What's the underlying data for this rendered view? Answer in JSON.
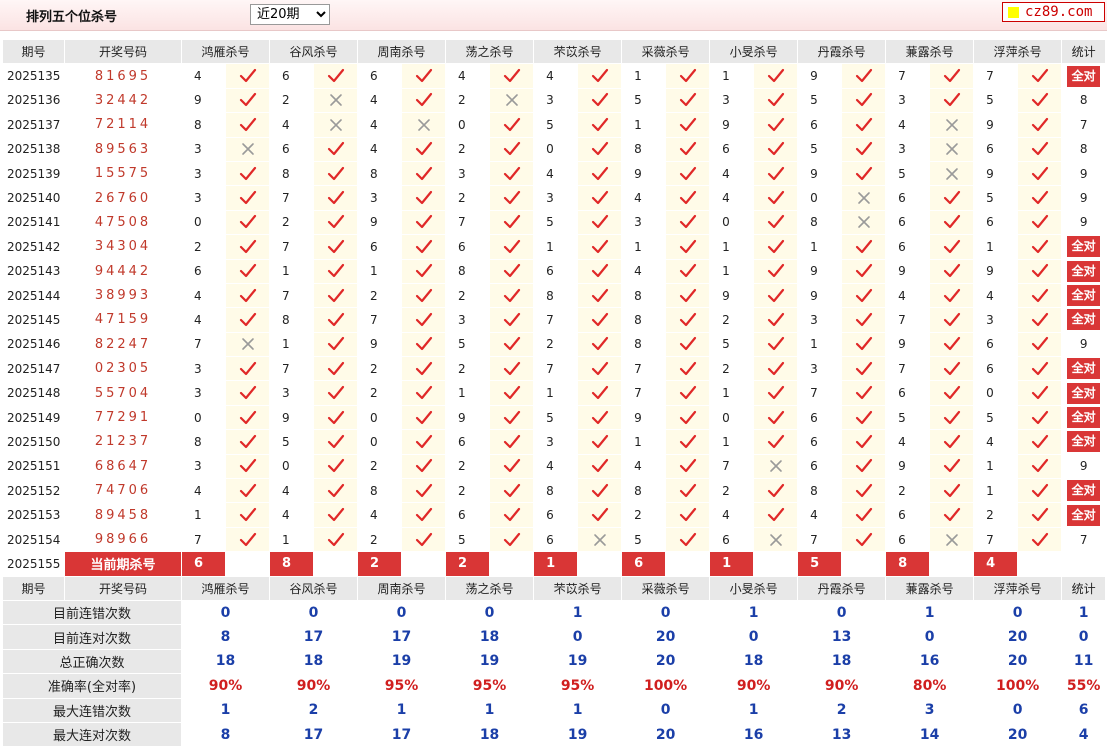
{
  "header": {
    "title": "排列五个位杀号",
    "range_selected": "近20期",
    "logo": "cz89.com"
  },
  "columns": {
    "period": "期号",
    "draw": "开奖号码",
    "experts": [
      "鸿雁杀号",
      "谷风杀号",
      "周南杀号",
      "荡之杀号",
      "芣苡杀号",
      "采薇杀号",
      "小旻杀号",
      "丹霞杀号",
      "蒹露杀号",
      "浮萍杀号"
    ],
    "stat": "统计"
  },
  "all_ok_label": "全对",
  "rows": [
    {
      "period": "2025135",
      "draw": "81695",
      "kills": [
        [
          4,
          1
        ],
        [
          6,
          1
        ],
        [
          6,
          1
        ],
        [
          4,
          1
        ],
        [
          4,
          1
        ],
        [
          1,
          1
        ],
        [
          1,
          1
        ],
        [
          9,
          1
        ],
        [
          7,
          1
        ],
        [
          7,
          1
        ]
      ],
      "stat": "全对"
    },
    {
      "period": "2025136",
      "draw": "32442",
      "kills": [
        [
          9,
          1
        ],
        [
          2,
          0
        ],
        [
          4,
          1
        ],
        [
          2,
          0
        ],
        [
          3,
          1
        ],
        [
          5,
          1
        ],
        [
          3,
          1
        ],
        [
          5,
          1
        ],
        [
          3,
          1
        ],
        [
          5,
          1
        ]
      ],
      "stat": "8"
    },
    {
      "period": "2025137",
      "draw": "72114",
      "kills": [
        [
          8,
          1
        ],
        [
          4,
          0
        ],
        [
          4,
          0
        ],
        [
          0,
          1
        ],
        [
          5,
          1
        ],
        [
          1,
          1
        ],
        [
          9,
          1
        ],
        [
          6,
          1
        ],
        [
          4,
          0
        ],
        [
          9,
          1
        ]
      ],
      "stat": "7"
    },
    {
      "period": "2025138",
      "draw": "89563",
      "kills": [
        [
          3,
          0
        ],
        [
          6,
          1
        ],
        [
          4,
          1
        ],
        [
          2,
          1
        ],
        [
          0,
          1
        ],
        [
          8,
          1
        ],
        [
          6,
          1
        ],
        [
          5,
          1
        ],
        [
          3,
          0
        ],
        [
          6,
          1
        ]
      ],
      "stat": "8"
    },
    {
      "period": "2025139",
      "draw": "15575",
      "kills": [
        [
          3,
          1
        ],
        [
          8,
          1
        ],
        [
          8,
          1
        ],
        [
          3,
          1
        ],
        [
          4,
          1
        ],
        [
          9,
          1
        ],
        [
          4,
          1
        ],
        [
          9,
          1
        ],
        [
          5,
          0
        ],
        [
          9,
          1
        ]
      ],
      "stat": "9"
    },
    {
      "period": "2025140",
      "draw": "26760",
      "kills": [
        [
          3,
          1
        ],
        [
          7,
          1
        ],
        [
          3,
          1
        ],
        [
          2,
          1
        ],
        [
          3,
          1
        ],
        [
          4,
          1
        ],
        [
          4,
          1
        ],
        [
          0,
          0
        ],
        [
          6,
          1
        ],
        [
          5,
          1
        ]
      ],
      "stat": "9"
    },
    {
      "period": "2025141",
      "draw": "47508",
      "kills": [
        [
          0,
          1
        ],
        [
          2,
          1
        ],
        [
          9,
          1
        ],
        [
          7,
          1
        ],
        [
          5,
          1
        ],
        [
          3,
          1
        ],
        [
          0,
          1
        ],
        [
          8,
          0
        ],
        [
          6,
          1
        ],
        [
          6,
          1
        ]
      ],
      "stat": "9"
    },
    {
      "period": "2025142",
      "draw": "34304",
      "kills": [
        [
          2,
          1
        ],
        [
          7,
          1
        ],
        [
          6,
          1
        ],
        [
          6,
          1
        ],
        [
          1,
          1
        ],
        [
          1,
          1
        ],
        [
          1,
          1
        ],
        [
          1,
          1
        ],
        [
          6,
          1
        ],
        [
          1,
          1
        ]
      ],
      "stat": "全对"
    },
    {
      "period": "2025143",
      "draw": "94442",
      "kills": [
        [
          6,
          1
        ],
        [
          1,
          1
        ],
        [
          1,
          1
        ],
        [
          8,
          1
        ],
        [
          6,
          1
        ],
        [
          4,
          1
        ],
        [
          1,
          1
        ],
        [
          9,
          1
        ],
        [
          9,
          1
        ],
        [
          9,
          1
        ]
      ],
      "stat": "全对"
    },
    {
      "period": "2025144",
      "draw": "38993",
      "kills": [
        [
          4,
          1
        ],
        [
          7,
          1
        ],
        [
          2,
          1
        ],
        [
          2,
          1
        ],
        [
          8,
          1
        ],
        [
          8,
          1
        ],
        [
          9,
          1
        ],
        [
          9,
          1
        ],
        [
          4,
          1
        ],
        [
          4,
          1
        ]
      ],
      "stat": "全对"
    },
    {
      "period": "2025145",
      "draw": "47159",
      "kills": [
        [
          4,
          1
        ],
        [
          8,
          1
        ],
        [
          7,
          1
        ],
        [
          3,
          1
        ],
        [
          7,
          1
        ],
        [
          8,
          1
        ],
        [
          2,
          1
        ],
        [
          3,
          1
        ],
        [
          7,
          1
        ],
        [
          3,
          1
        ]
      ],
      "stat": "全对"
    },
    {
      "period": "2025146",
      "draw": "82247",
      "kills": [
        [
          7,
          0
        ],
        [
          1,
          1
        ],
        [
          9,
          1
        ],
        [
          5,
          1
        ],
        [
          2,
          1
        ],
        [
          8,
          1
        ],
        [
          5,
          1
        ],
        [
          1,
          1
        ],
        [
          9,
          1
        ],
        [
          6,
          1
        ]
      ],
      "stat": "9"
    },
    {
      "period": "2025147",
      "draw": "02305",
      "kills": [
        [
          3,
          1
        ],
        [
          7,
          1
        ],
        [
          2,
          1
        ],
        [
          2,
          1
        ],
        [
          7,
          1
        ],
        [
          7,
          1
        ],
        [
          2,
          1
        ],
        [
          3,
          1
        ],
        [
          7,
          1
        ],
        [
          6,
          1
        ]
      ],
      "stat": "全对"
    },
    {
      "period": "2025148",
      "draw": "55704",
      "kills": [
        [
          3,
          1
        ],
        [
          3,
          1
        ],
        [
          2,
          1
        ],
        [
          1,
          1
        ],
        [
          1,
          1
        ],
        [
          7,
          1
        ],
        [
          1,
          1
        ],
        [
          7,
          1
        ],
        [
          6,
          1
        ],
        [
          0,
          1
        ]
      ],
      "stat": "全对"
    },
    {
      "period": "2025149",
      "draw": "77291",
      "kills": [
        [
          0,
          1
        ],
        [
          9,
          1
        ],
        [
          0,
          1
        ],
        [
          9,
          1
        ],
        [
          5,
          1
        ],
        [
          9,
          1
        ],
        [
          0,
          1
        ],
        [
          6,
          1
        ],
        [
          5,
          1
        ],
        [
          5,
          1
        ]
      ],
      "stat": "全对"
    },
    {
      "period": "2025150",
      "draw": "21237",
      "kills": [
        [
          8,
          1
        ],
        [
          5,
          1
        ],
        [
          0,
          1
        ],
        [
          6,
          1
        ],
        [
          3,
          1
        ],
        [
          1,
          1
        ],
        [
          1,
          1
        ],
        [
          6,
          1
        ],
        [
          4,
          1
        ],
        [
          4,
          1
        ]
      ],
      "stat": "全对"
    },
    {
      "period": "2025151",
      "draw": "68647",
      "kills": [
        [
          3,
          1
        ],
        [
          0,
          1
        ],
        [
          2,
          1
        ],
        [
          2,
          1
        ],
        [
          4,
          1
        ],
        [
          4,
          1
        ],
        [
          7,
          0
        ],
        [
          6,
          1
        ],
        [
          9,
          1
        ],
        [
          1,
          1
        ]
      ],
      "stat": "9"
    },
    {
      "period": "2025152",
      "draw": "74706",
      "kills": [
        [
          4,
          1
        ],
        [
          4,
          1
        ],
        [
          8,
          1
        ],
        [
          2,
          1
        ],
        [
          8,
          1
        ],
        [
          8,
          1
        ],
        [
          2,
          1
        ],
        [
          8,
          1
        ],
        [
          2,
          1
        ],
        [
          1,
          1
        ]
      ],
      "stat": "全对"
    },
    {
      "period": "2025153",
      "draw": "89458",
      "kills": [
        [
          1,
          1
        ],
        [
          4,
          1
        ],
        [
          4,
          1
        ],
        [
          6,
          1
        ],
        [
          6,
          1
        ],
        [
          2,
          1
        ],
        [
          4,
          1
        ],
        [
          4,
          1
        ],
        [
          6,
          1
        ],
        [
          2,
          1
        ]
      ],
      "stat": "全对"
    },
    {
      "period": "2025154",
      "draw": "98966",
      "kills": [
        [
          7,
          1
        ],
        [
          1,
          1
        ],
        [
          2,
          1
        ],
        [
          5,
          1
        ],
        [
          6,
          0
        ],
        [
          5,
          1
        ],
        [
          6,
          0
        ],
        [
          7,
          1
        ],
        [
          6,
          0
        ],
        [
          7,
          1
        ]
      ],
      "stat": "7"
    }
  ],
  "current": {
    "period": "2025155",
    "label": "当前期杀号",
    "kills": [
      "6",
      "8",
      "2",
      "2",
      "1",
      "6",
      "1",
      "5",
      "8",
      "4"
    ]
  },
  "stats": [
    {
      "label": "目前连错次数",
      "values": [
        "0",
        "0",
        "0",
        "0",
        "1",
        "0",
        "1",
        "0",
        "1",
        "0",
        "1"
      ]
    },
    {
      "label": "目前连对次数",
      "values": [
        "8",
        "17",
        "17",
        "18",
        "0",
        "20",
        "0",
        "13",
        "0",
        "20",
        "0"
      ]
    },
    {
      "label": "总正确次数",
      "values": [
        "18",
        "18",
        "19",
        "19",
        "19",
        "20",
        "18",
        "18",
        "16",
        "20",
        "11"
      ]
    },
    {
      "label": "准确率(全对率)",
      "values": [
        "90%",
        "90%",
        "95%",
        "95%",
        "95%",
        "100%",
        "90%",
        "90%",
        "80%",
        "100%",
        "55%"
      ],
      "highlight": true
    },
    {
      "label": "最大连错次数",
      "values": [
        "1",
        "2",
        "1",
        "1",
        "1",
        "0",
        "1",
        "2",
        "3",
        "0",
        "6"
      ]
    },
    {
      "label": "最大连对次数",
      "values": [
        "8",
        "17",
        "17",
        "18",
        "19",
        "20",
        "16",
        "13",
        "14",
        "20",
        "4"
      ]
    }
  ]
}
